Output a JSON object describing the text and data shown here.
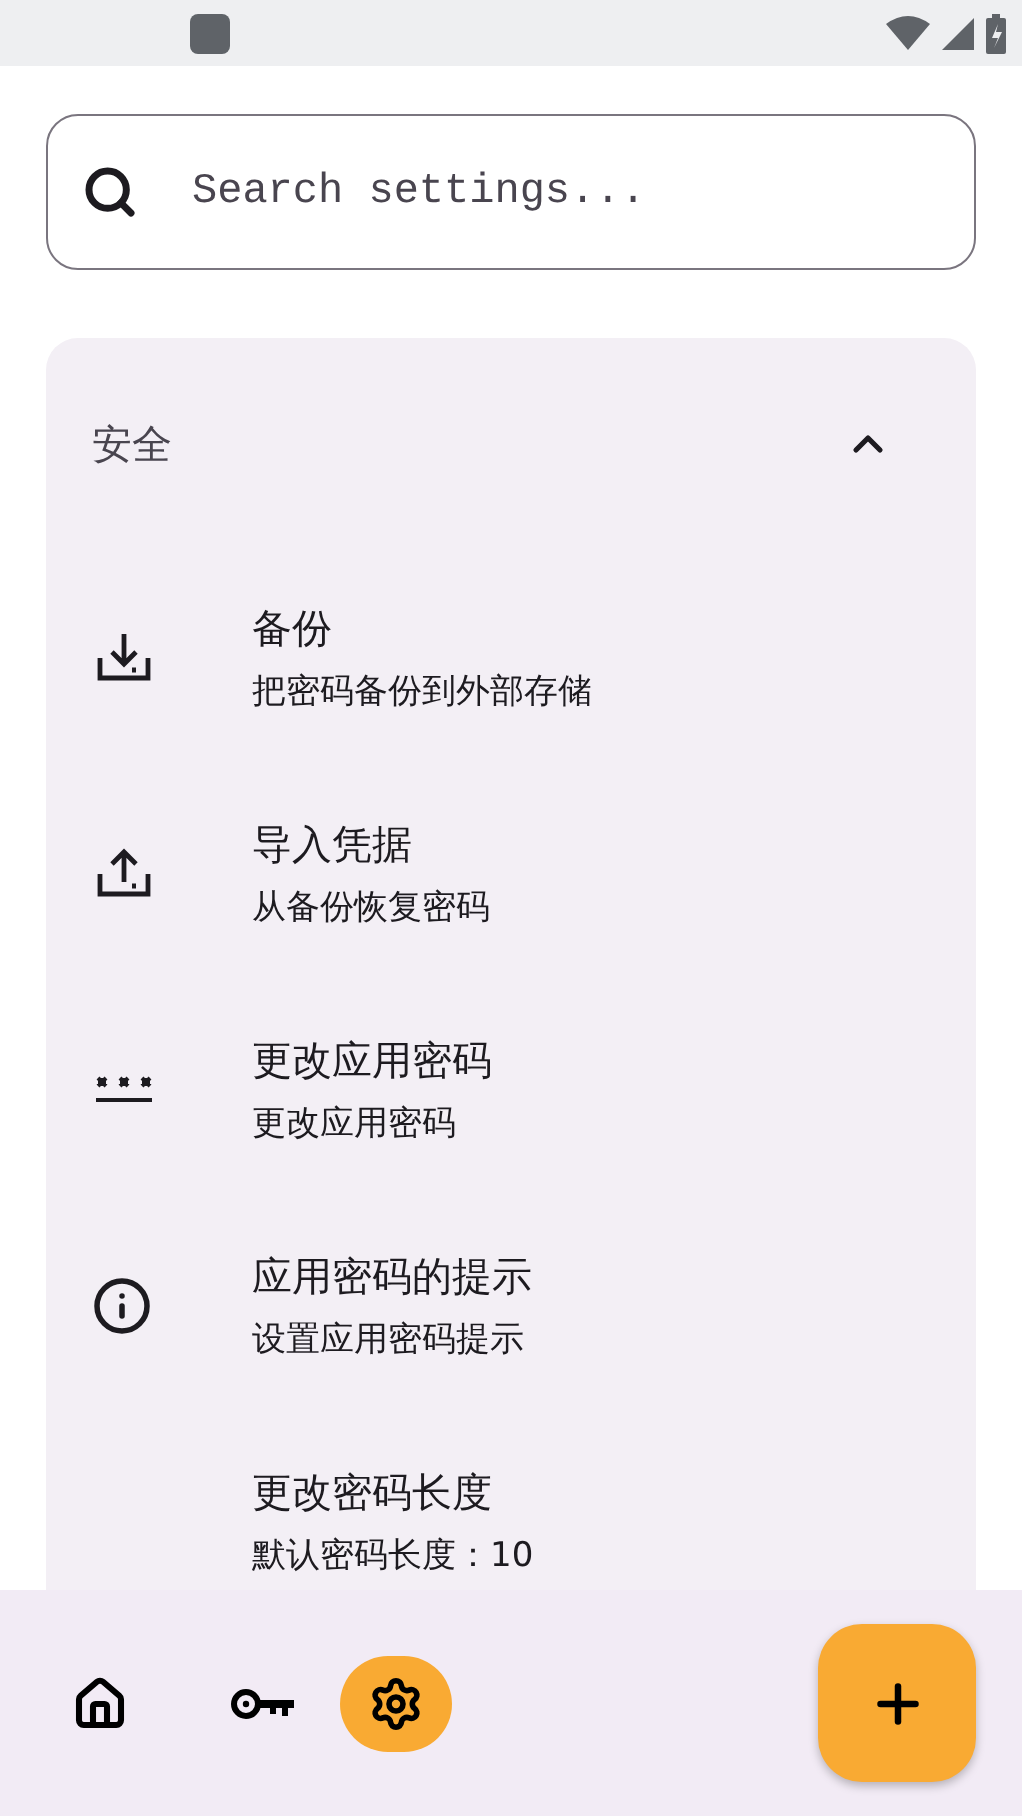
{
  "search": {
    "placeholder": "Search settings..."
  },
  "section": {
    "title": "安全",
    "expanded": true,
    "items": [
      {
        "title": "备份",
        "subtitle": "把密码备份到外部存储"
      },
      {
        "title": "导入凭据",
        "subtitle": "从备份恢复密码"
      },
      {
        "title": "更改应用密码",
        "subtitle": "更改应用密码"
      },
      {
        "title": "应用密码的提示",
        "subtitle": "设置应用密码提示"
      },
      {
        "title": "更改密码长度",
        "subtitle": "默认密码长度：10"
      }
    ]
  },
  "nav": [
    {
      "selected": false
    },
    {
      "selected": false
    },
    {
      "selected": true
    }
  ]
}
